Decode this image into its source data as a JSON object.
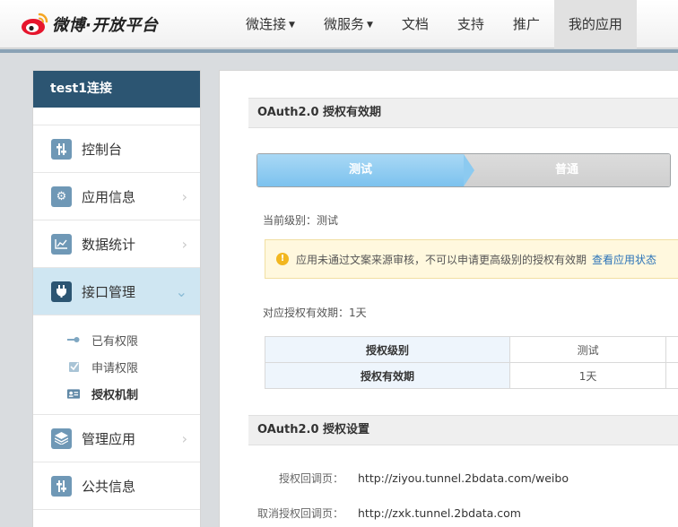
{
  "header": {
    "brand": "微博·开放平台",
    "nav": [
      {
        "label": "微连接",
        "caret": true
      },
      {
        "label": "微服务",
        "caret": true
      },
      {
        "label": "文档",
        "caret": false
      },
      {
        "label": "支持",
        "caret": false
      },
      {
        "label": "推广",
        "caret": false
      },
      {
        "label": "我的应用",
        "caret": false,
        "active": true
      }
    ]
  },
  "sidebar": {
    "title": "test1连接",
    "items": [
      {
        "label": "控制台",
        "icon": "sliders-icon"
      },
      {
        "label": "应用信息",
        "icon": "gear-icon"
      },
      {
        "label": "数据统计",
        "icon": "line-chart-icon"
      },
      {
        "label": "接口管理",
        "icon": "plug-icon",
        "active": true
      },
      {
        "label": "管理应用",
        "icon": "layers-icon"
      },
      {
        "label": "公共信息",
        "icon": "sliders-icon"
      }
    ],
    "sub_items": [
      {
        "label": "已有权限",
        "icon": "key-icon"
      },
      {
        "label": "申请权限",
        "icon": "checkbox-icon"
      },
      {
        "label": "授权机制",
        "icon": "id-card-icon",
        "bold": true
      }
    ]
  },
  "oauth_validity": {
    "heading": "OAuth2.0 授权有效期",
    "steps": [
      "测试",
      "普通"
    ],
    "current_level": "当前级别：测试",
    "alert_text": "应用未通过文案来源审核，不可以申请更高级别的授权有效期",
    "alert_link": "查看应用状态",
    "validity_text": "对应授权有效期：1天",
    "table": [
      {
        "header": "授权级别",
        "value": "测试"
      },
      {
        "header": "授权有效期",
        "value": "1天"
      }
    ]
  },
  "oauth_settings": {
    "heading": "OAuth2.0 授权设置",
    "rows": [
      {
        "label": "授权回调页：",
        "value": "http://ziyou.tunnel.2bdata.com/weibo"
      },
      {
        "label": "取消授权回调页：",
        "value": "http://zxk.tunnel.2bdata.com"
      }
    ]
  },
  "colors": {
    "sidebar_title_bg": "#2c5572",
    "active_item_bg": "#cfe6f2",
    "step_active": "#7cc2ee",
    "alert_bg": "#fff8de",
    "link": "#2b73b8"
  }
}
